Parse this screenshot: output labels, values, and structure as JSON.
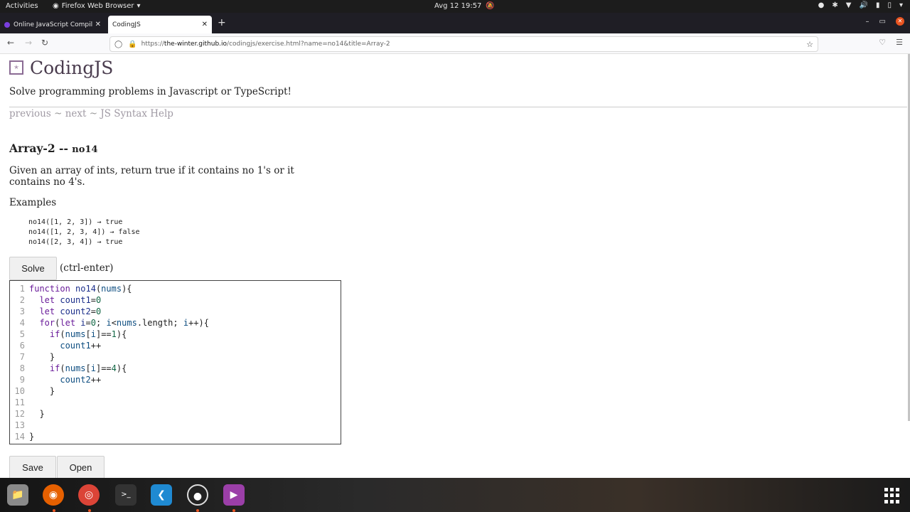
{
  "topbar": {
    "activities": "Activities",
    "app_name": "Firefox Web Browser",
    "clock": "Avg 12  19:57"
  },
  "tabs": [
    {
      "label": "Online JavaScript Compil",
      "active": false
    },
    {
      "label": "CodingJS",
      "active": true
    }
  ],
  "url": {
    "prefix": "https://",
    "host": "the-winter.github.io",
    "path": "/codingjs/exercise.html?name=no14&title=Array-2"
  },
  "page": {
    "site_title": "CodingJS",
    "tagline": "Solve programming problems in Javascript or TypeScript!",
    "nav": {
      "previous": "previous",
      "sep1": " ~ ",
      "next": "next",
      "sep2": " ~ ",
      "help": "JS Syntax Help"
    },
    "title_main": "Array-2 -- ",
    "title_sub": "no14",
    "description": "Given an array of ints, return true if it contains no 1's or it contains no 4's.",
    "examples_heading": "Examples",
    "examples": [
      "no14([1, 2, 3]) → true",
      "no14([1, 2, 3, 4]) → false",
      "no14([2, 3, 4]) → true"
    ],
    "solve_label": "Solve",
    "hint": "(ctrl-enter)",
    "save_label": "Save",
    "open_label": "Open"
  },
  "editor": {
    "line_numbers": [
      "1",
      "2",
      "3",
      "4",
      "5",
      "6",
      "7",
      "8",
      "9",
      "10",
      "11",
      "12",
      "13",
      "14"
    ]
  },
  "colors": {
    "accent": "#e95420",
    "logo": "#8b6b94"
  }
}
